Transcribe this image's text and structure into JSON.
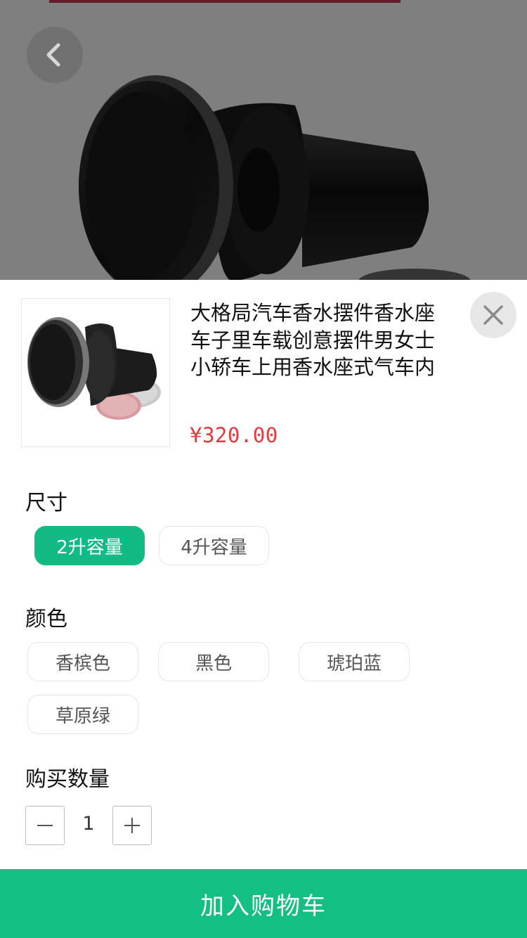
{
  "product": {
    "title": "大格局汽车香水摆件香水座车子里车载创意摆件男女士小轿车上用香水座式气车内",
    "price": "¥320.00"
  },
  "options": {
    "size": {
      "label": "尺寸",
      "items": [
        "2升容量",
        "4升容量"
      ],
      "selected": "2升容量"
    },
    "color": {
      "label": "颜色",
      "items": [
        "香槟色",
        "黑色",
        "琥珀蓝",
        "草原绿"
      ]
    }
  },
  "quantity": {
    "label": "购买数量",
    "value": "1"
  },
  "actions": {
    "add_to_cart": "加入购物车"
  },
  "icons": {
    "back": "chevron-left-icon",
    "close": "close-icon",
    "minus": "minus-icon",
    "plus": "plus-icon"
  },
  "colors": {
    "accent": "#14bf83",
    "price": "#e8383d"
  }
}
